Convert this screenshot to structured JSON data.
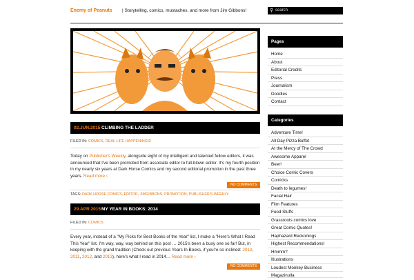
{
  "header": {
    "site_title": "Enemy of Peanuts",
    "tagline": "| Storytelling, comics, mustaches, and more from Jim Gibbons!"
  },
  "search": {
    "placeholder": "search",
    "icon": "search-icon"
  },
  "colors": {
    "accent": "#e8770d",
    "bar": "#000000",
    "hero_fill": "#f29a3a"
  },
  "posts": [
    {
      "date": "02.JUN.2015",
      "title": "Climbing the Ladder",
      "filed_label": "FILED IN:",
      "categories": "COMICS, REAL LIFE HAPPENINGS!",
      "body_1": "Today on ",
      "link_1": "Publisher's Weekly",
      "body_2": ", alongside eight of my intelligent and talented fellow editors, it was announced that I've been promoted from associate editor to full-blown editor. It's my fourth position in my nearly six years at Dark Horse Comics and my second editorial promotion in the past three years.",
      "read_more": "Read more ›",
      "comments": "NO COMMENTS",
      "tags_label": "TAGS:",
      "tags": "DARK HORSE COMICS, EDITOR, JIMGIBBONS, PROMOTION, PUBLISHER'S WEEKLY"
    },
    {
      "date": "29.APR.2015",
      "title": "My Year in Books: 2014",
      "filed_label": "FILED IN:",
      "categories": "COMICS",
      "body_1": "Every year, instead of a \"My Picks for Best Books of the Year\" list, I make a \"Here's What I Read This Year\" list. I'm way, way, way behind on this post … 2015's been a busy one so far! But, in keeping with the grand tradition (Check out previous Years In Books, if you're so inclined: ",
      "years": [
        "2010",
        "2011",
        "2012"
      ],
      "body_and": ", and ",
      "year_last": "2013",
      "body_2": "), here's what I read in 2014… ",
      "read_more": "Read more ›",
      "comments": "NO COMMENTS"
    }
  ],
  "sidebar": {
    "pages_title": "Pages",
    "pages": [
      "Home",
      "About",
      "Editorial Credits",
      "Press",
      "Journalism",
      "Doodles",
      "Contact"
    ],
    "categories_title": "Categories",
    "categories": [
      "Adventure Time!",
      "All Day Pizza Buffet",
      "At the Mercy of The Crowd",
      "Awesome Apparel",
      "Beer!",
      "Choice Comic Covers",
      "Comicks",
      "Death to legumes!",
      "Facial Hair",
      "Film Features",
      "Food Stuffs",
      "Grassroots comics love",
      "Great Comic Quotes!",
      "Haphazard Reckonings",
      "Highest Recommendations!",
      "Hmmm?",
      "Illustrations",
      "Loudest Monkey Business",
      "Magazinulla"
    ]
  }
}
